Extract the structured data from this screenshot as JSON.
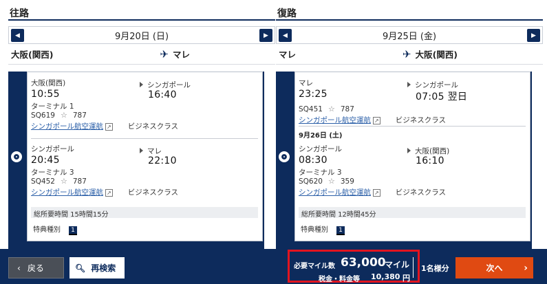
{
  "outbound": {
    "title": "往路",
    "date": "9月20日 (日)",
    "origin": "大阪(関西)",
    "destination": "マレ",
    "seg1": {
      "from": "大阪(関西)",
      "to": "シンガポール",
      "dep_time": "10:55",
      "arr_time": "16:40",
      "terminal": "ターミナル 1",
      "flight": "SQ619",
      "aircraft": "787",
      "airline": "シンガポール航空運航",
      "cabin": "ビジネスクラス"
    },
    "seg2": {
      "from": "シンガポール",
      "to": "マレ",
      "dep_time": "20:45",
      "arr_time": "22:10",
      "terminal": "ターミナル 3",
      "flight": "SQ452",
      "aircraft": "787",
      "airline": "シンガポール航空運航",
      "cabin": "ビジネスクラス"
    },
    "total": "総所要時間 15時間15分",
    "award_label": "特典種別",
    "award_value": "1"
  },
  "return": {
    "title": "復路",
    "date": "9月25日 (金)",
    "origin": "マレ",
    "destination": "大阪(関西)",
    "seg1": {
      "from": "マレ",
      "to": "シンガポール",
      "dep_time": "23:25",
      "arr_time": "07:05 翌日",
      "flight": "SQ451",
      "aircraft": "787",
      "airline": "シンガポール航空運航",
      "cabin": "ビジネスクラス"
    },
    "seg2_date": "9月26日 (土)",
    "seg2": {
      "from": "シンガポール",
      "to": "大阪(関西)",
      "dep_time": "08:30",
      "arr_time": "16:10",
      "terminal": "ターミナル 3",
      "flight": "SQ620",
      "aircraft": "359",
      "airline": "シンガポール航空運航",
      "cabin": "ビジネスクラス"
    },
    "total": "総所要時間 12時間45分",
    "award_label": "特典種別",
    "award_value": "1"
  },
  "footer": {
    "back_label": "戻る",
    "search_label": "再検索",
    "miles_label": "必要マイル数",
    "miles_value": "63,000",
    "miles_unit": "マイル",
    "tax_label": "税金・料金等",
    "tax_value": "10,380",
    "tax_unit": "円",
    "persons": "1名様分",
    "next_label": "次へ"
  },
  "colors": {
    "navy": "#0d2b5c",
    "next_button": "#e04a12",
    "highlight_border": "#e3141f"
  }
}
